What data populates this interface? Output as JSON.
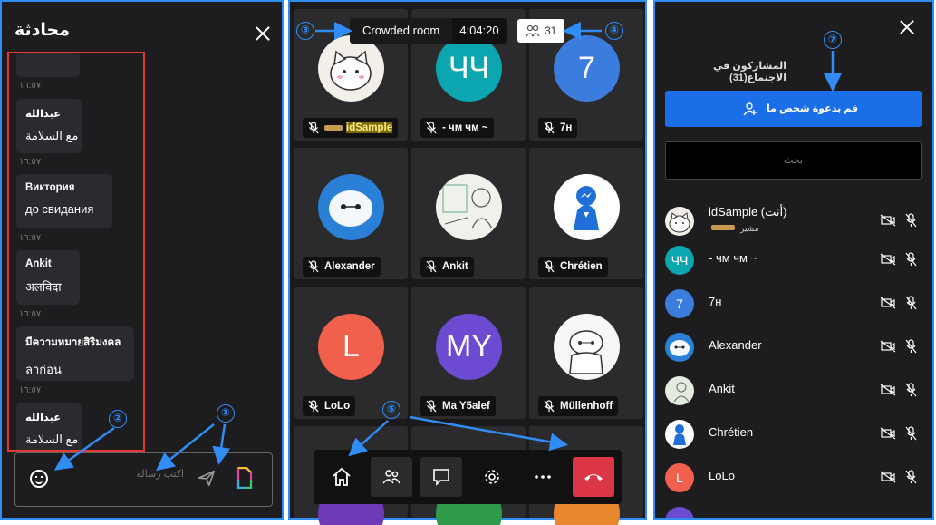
{
  "chat": {
    "title": "محادثة",
    "messages": [
      {
        "time": "١٦:٥٧"
      },
      {
        "name": "عبدالله",
        "text": "مع السلامة",
        "time": "١٦:٥٧"
      },
      {
        "name": "Виктория",
        "text": "до свидания",
        "time": "١٦:٥٧"
      },
      {
        "name": "Ankit",
        "text": "अलविदा",
        "time": "١٦:٥٧"
      },
      {
        "name": "มีความหมายสิริมงคล",
        "text": "ลาก่อน",
        "time": "١٦:٥٧"
      },
      {
        "name": "عبدالله",
        "text": "مع السلامة"
      }
    ],
    "input_placeholder": "اكتب رسالة"
  },
  "room": {
    "name": "Crowded room",
    "time": "4:04:20",
    "participant_count": "31"
  },
  "tiles": [
    {
      "name": "idSample",
      "avatar_icon": "cat-avatar"
    },
    {
      "name": "- чм чм ~",
      "avatar_text": "ЧЧ",
      "color": "#0ba6b0"
    },
    {
      "name": "7н",
      "avatar_text": "7",
      "color": "#3b7ddd"
    },
    {
      "name": "Alexander",
      "avatar_icon": "baymax-avatar"
    },
    {
      "name": "Ankit",
      "avatar_icon": "sketch-avatar"
    },
    {
      "name": "Chrétien",
      "avatar_icon": "messenger-avatar"
    },
    {
      "name": "LoLo",
      "avatar_text": "L",
      "color": "#f0604d"
    },
    {
      "name": "Ma Y5alef",
      "avatar_text": "MY",
      "color": "#6c4bd2"
    },
    {
      "name": "Müllenhoff",
      "avatar_icon": "baymax-drawing-avatar"
    }
  ],
  "participants": {
    "title": "المشاركون في الاجتماع(31)",
    "invite_label": "قم بدعوة شخص ما",
    "search_placeholder": "بحث",
    "list": [
      {
        "name": "idSample (أنت)",
        "role": "مشير",
        "avatar_icon": "cat-avatar"
      },
      {
        "name": "- чм чм ~",
        "avatar_text": "ЧЧ",
        "color": "#0ba6b0"
      },
      {
        "name": "7н",
        "avatar_text": "7",
        "color": "#3b7ddd"
      },
      {
        "name": "Alexander",
        "avatar_icon": "baymax-avatar"
      },
      {
        "name": "Ankit",
        "avatar_icon": "sketch-avatar"
      },
      {
        "name": "Chrétien",
        "avatar_icon": "messenger-avatar"
      },
      {
        "name": "LoLo",
        "avatar_text": "L",
        "color": "#f0604d"
      }
    ]
  },
  "annotations": [
    "①",
    "②",
    "③",
    "④",
    "⑤",
    "⑦"
  ],
  "colors": {
    "accent": "#2f8df5",
    "highlight": "#e53935",
    "hangup": "#dc3545",
    "invite": "#1a6ee8"
  }
}
